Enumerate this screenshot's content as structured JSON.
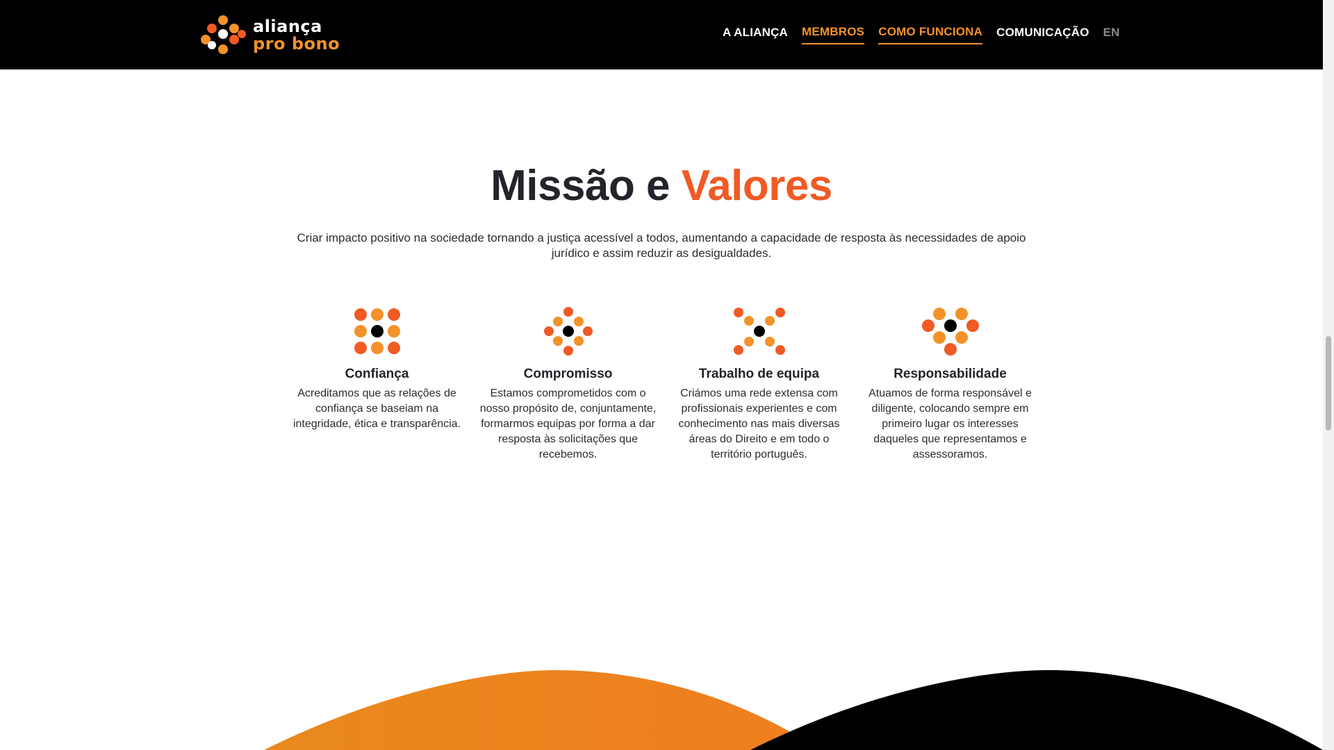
{
  "header": {
    "logo": {
      "line1": "aliança",
      "line2": "pro bono"
    },
    "nav": [
      {
        "label": "A ALIANÇA",
        "active": false
      },
      {
        "label": "MEMBROS",
        "active": true
      },
      {
        "label": "COMO FUNCIONA",
        "active": true
      },
      {
        "label": "COMUNICAÇÃO",
        "active": false
      },
      {
        "label": "EN",
        "active": false
      }
    ]
  },
  "main": {
    "title_part1": "Missão e",
    "title_part2": "Valores",
    "intro": "Criar impacto positivo na sociedade tornando a justiça acessível a todos, aumentando a capacidade de resposta às necessidades de apoio jurídico e assim reduzir as desigualdades.",
    "values": [
      {
        "title": "Confiança",
        "text": "Acreditamos que as relações de confiança se baseiam na integridade, ética e transparência.",
        "icon": "dots-grid-icon"
      },
      {
        "title": "Compromisso",
        "text": "Estamos comprometidos com o nosso propósito de, conjuntamente, formarmos equipas por forma a dar resposta às solicitações que recebemos.",
        "icon": "dots-diamond-icon"
      },
      {
        "title": "Trabalho de equipa",
        "text": "Criámos uma rede extensa com profissionais experientes e com conhecimento nas mais diversas áreas do Direito e em todo o território português.",
        "icon": "dots-x-icon"
      },
      {
        "title": "Responsabilidade",
        "text": "Atuamos de forma responsável e diligente, colocando sempre em primeiro lugar os interesses daqueles que representamos e assessoramos.",
        "icon": "dots-flower-icon"
      }
    ]
  },
  "colors": {
    "black": "#000000",
    "orange": "#f3922a",
    "red_orange": "#f05a24",
    "arc_orange": "#e8891e",
    "text": "#23232b"
  }
}
